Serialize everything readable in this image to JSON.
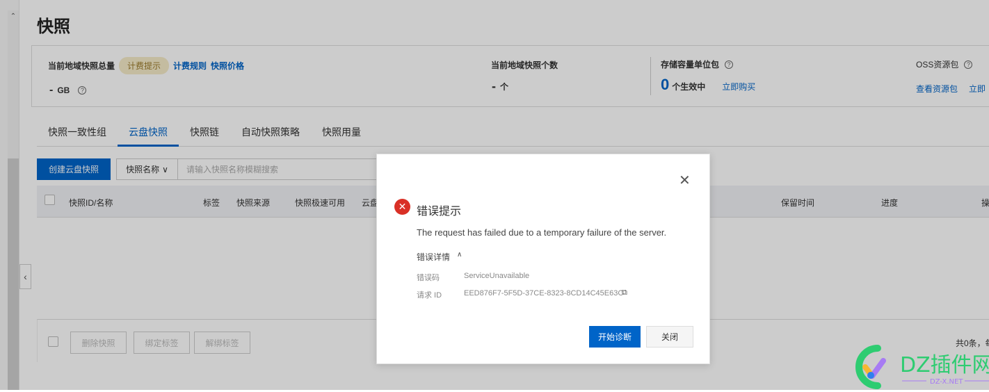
{
  "page": {
    "title": "快照"
  },
  "summary": {
    "total_label": "当前地域快照总量",
    "billing_badge": "计费提示",
    "billing_rules": "计费规则",
    "snapshot_price": "快照价格",
    "total_value": "-",
    "total_unit": "GB",
    "count_label": "当前地域快照个数",
    "count_value": "-",
    "count_unit": "个",
    "storage_label": "存储容量单位包",
    "storage_value": "0",
    "storage_unit": "个生效中",
    "buy_now": "立即购买",
    "oss_label": "OSS资源包",
    "view_packages": "查看资源包",
    "oss_buy": "立即"
  },
  "tabs": [
    {
      "label": "快照一致性组"
    },
    {
      "label": "云盘快照",
      "active": true
    },
    {
      "label": "快照链"
    },
    {
      "label": "自动快照策略"
    },
    {
      "label": "快照用量"
    }
  ],
  "toolbar": {
    "create": "创建云盘快照",
    "filter_select": "快照名称",
    "search_placeholder": "请输入快照名称模糊搜索"
  },
  "table": {
    "columns": [
      "快照ID/名称",
      "标签",
      "快照来源",
      "快照极速可用",
      "云盘",
      "保留时间",
      "进度",
      "操"
    ]
  },
  "footer": {
    "delete": "删除快照",
    "bind_tag": "绑定标签",
    "unbind_tag": "解绑标签",
    "total": "共0条，每"
  },
  "dialog": {
    "title": "错误提示",
    "message": "The request has failed due to a temporary failure of the server.",
    "details_toggle": "错误详情",
    "code_label": "错误码",
    "code_value": "ServiceUnavailable",
    "request_label": "请求 ID",
    "request_value": "EED876F7-5F5D-37CE-8323-8CD14C45E63C",
    "diagnose": "开始诊断",
    "close": "关闭"
  },
  "watermark": {
    "text": "DZ插件网",
    "sub": "DZ-X.NET"
  },
  "colors": {
    "primary": "#0064c8",
    "error": "#d93026",
    "badge_bg": "#f6ebc9"
  }
}
